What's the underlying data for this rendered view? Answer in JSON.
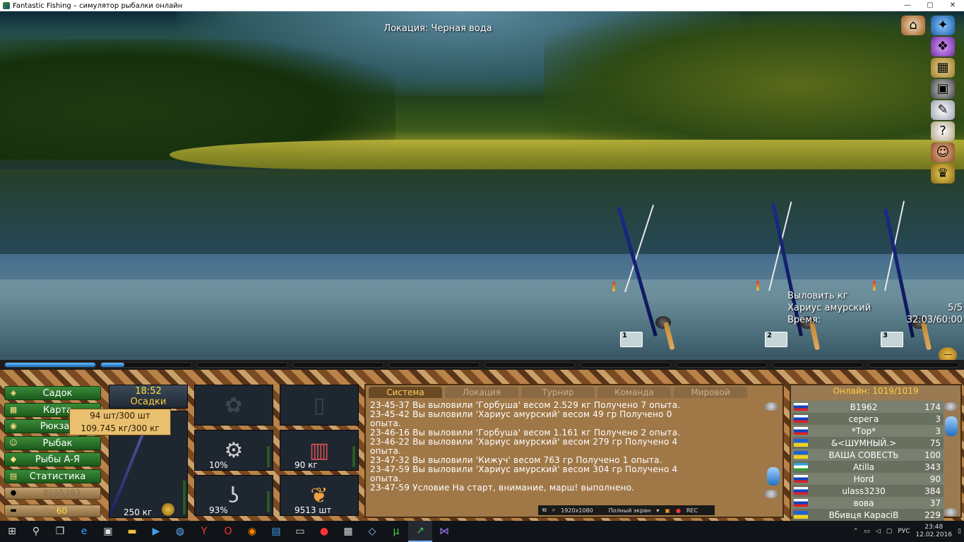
{
  "window": {
    "title": "Fantastic Fishing – симулятор рыбалки онлайн",
    "minimize": "—",
    "maximize": "▢",
    "close": "✕"
  },
  "scene": {
    "location": "Локация: Черная вода",
    "rods": [
      {
        "number": "1"
      },
      {
        "number": "2"
      },
      {
        "number": "3"
      }
    ],
    "task": {
      "line1": "Выловить кг",
      "fish": "Хариус амурский",
      "count": "5/5",
      "time_label": "Время:",
      "time_value": "32:03/60:00"
    }
  },
  "side_icons": [
    "home-icon",
    "compass-icon",
    "gift-icon",
    "map-icon",
    "box-icon",
    "notes-icon",
    "help-book-icon",
    "fisherman-face-icon",
    "trophy-icon"
  ],
  "menu": {
    "items": [
      {
        "label": "Садок",
        "icon": "keepnet-icon"
      },
      {
        "label": "Карта",
        "icon": "map-icon"
      },
      {
        "label": "Рюкзак",
        "icon": "backpack-icon"
      },
      {
        "label": "Рыбак",
        "icon": "fisherman-icon"
      },
      {
        "label": "Рыбы А-Я",
        "icon": "fish-icon"
      },
      {
        "label": "Статистика",
        "icon": "stats-icon"
      }
    ],
    "money": "8595393",
    "gold": "60"
  },
  "tooltip": {
    "line1": "94 шт/300 шт",
    "line2": "109.745 кг/300 кг"
  },
  "weather": {
    "time": "18:52",
    "condition": "Осадки"
  },
  "equipment": {
    "rod": "250 кг",
    "reel": "10%",
    "line": "90 кг",
    "hook": "93%",
    "bait": "9513 шт"
  },
  "chat": {
    "tabs": [
      "Система",
      "Локация",
      "Турнир",
      "Команда",
      "Мировой"
    ],
    "active_tab": "Система",
    "lines": [
      "23-45-37 Вы выловили 'Горбуша' весом 2.529 кг Получено 7 опыта.",
      "23-45-42 Вы выловили 'Хариус амурский' весом 49 гр Получено 0",
      "опыта.",
      "23-46-16 Вы выловили 'Горбуша' весом 1.161 кг Получено 2 опыта.",
      "23-46-22 Вы выловили 'Хариус амурский' весом 279 гр Получено 4",
      "опыта.",
      "23-47-32 Вы выловили 'Кижуч' весом 763 гр Получено 1 опыта.",
      "23-47-59 Вы выловили 'Хариус амурский' весом 304 гр Получено 4",
      "опыта.",
      "23-47-59 Условие На старт, внимание, марш! выполнено."
    ],
    "recorder": {
      "resolution": "1920x1080",
      "mode": "Полный экран",
      "rec": "REC"
    }
  },
  "online": {
    "header": "Онлайн: 1019/1019",
    "players": [
      {
        "name": "B1962",
        "level": "174",
        "flag": "ru"
      },
      {
        "name": "серега",
        "level": "3",
        "flag": "ru"
      },
      {
        "name": "*Тор*",
        "level": "3",
        "flag": "ru"
      },
      {
        "name": "&<ШУМНЫЙ.>",
        "level": "75",
        "flag": "ua"
      },
      {
        "name": "ВАША СОВЕСТЬ",
        "level": "100",
        "flag": "ua"
      },
      {
        "name": "Atilla",
        "level": "343",
        "flag": "uz"
      },
      {
        "name": "Hord",
        "level": "90",
        "flag": "ru"
      },
      {
        "name": "ulass3230",
        "level": "384",
        "flag": "ru"
      },
      {
        "name": "вова",
        "level": "37",
        "flag": "ru"
      },
      {
        "name": "Вбивця КарасіВ",
        "level": "229",
        "flag": "ua"
      }
    ]
  },
  "taskbar": {
    "apps": [
      "start-icon",
      "search-icon",
      "task-view-icon",
      "edge-icon",
      "store-icon",
      "explorer-icon",
      "media-icon",
      "network-icon",
      "yandex-icon",
      "opera-icon",
      "firefox-icon",
      "photo-icon",
      "terminal-icon",
      "record-icon",
      "gallery-icon",
      "tool-icon",
      "utorrent-icon",
      "fishing-app-icon",
      "visual-studio-icon"
    ],
    "lang": "РУС",
    "time": "23:48",
    "date": "12.02.2016"
  }
}
